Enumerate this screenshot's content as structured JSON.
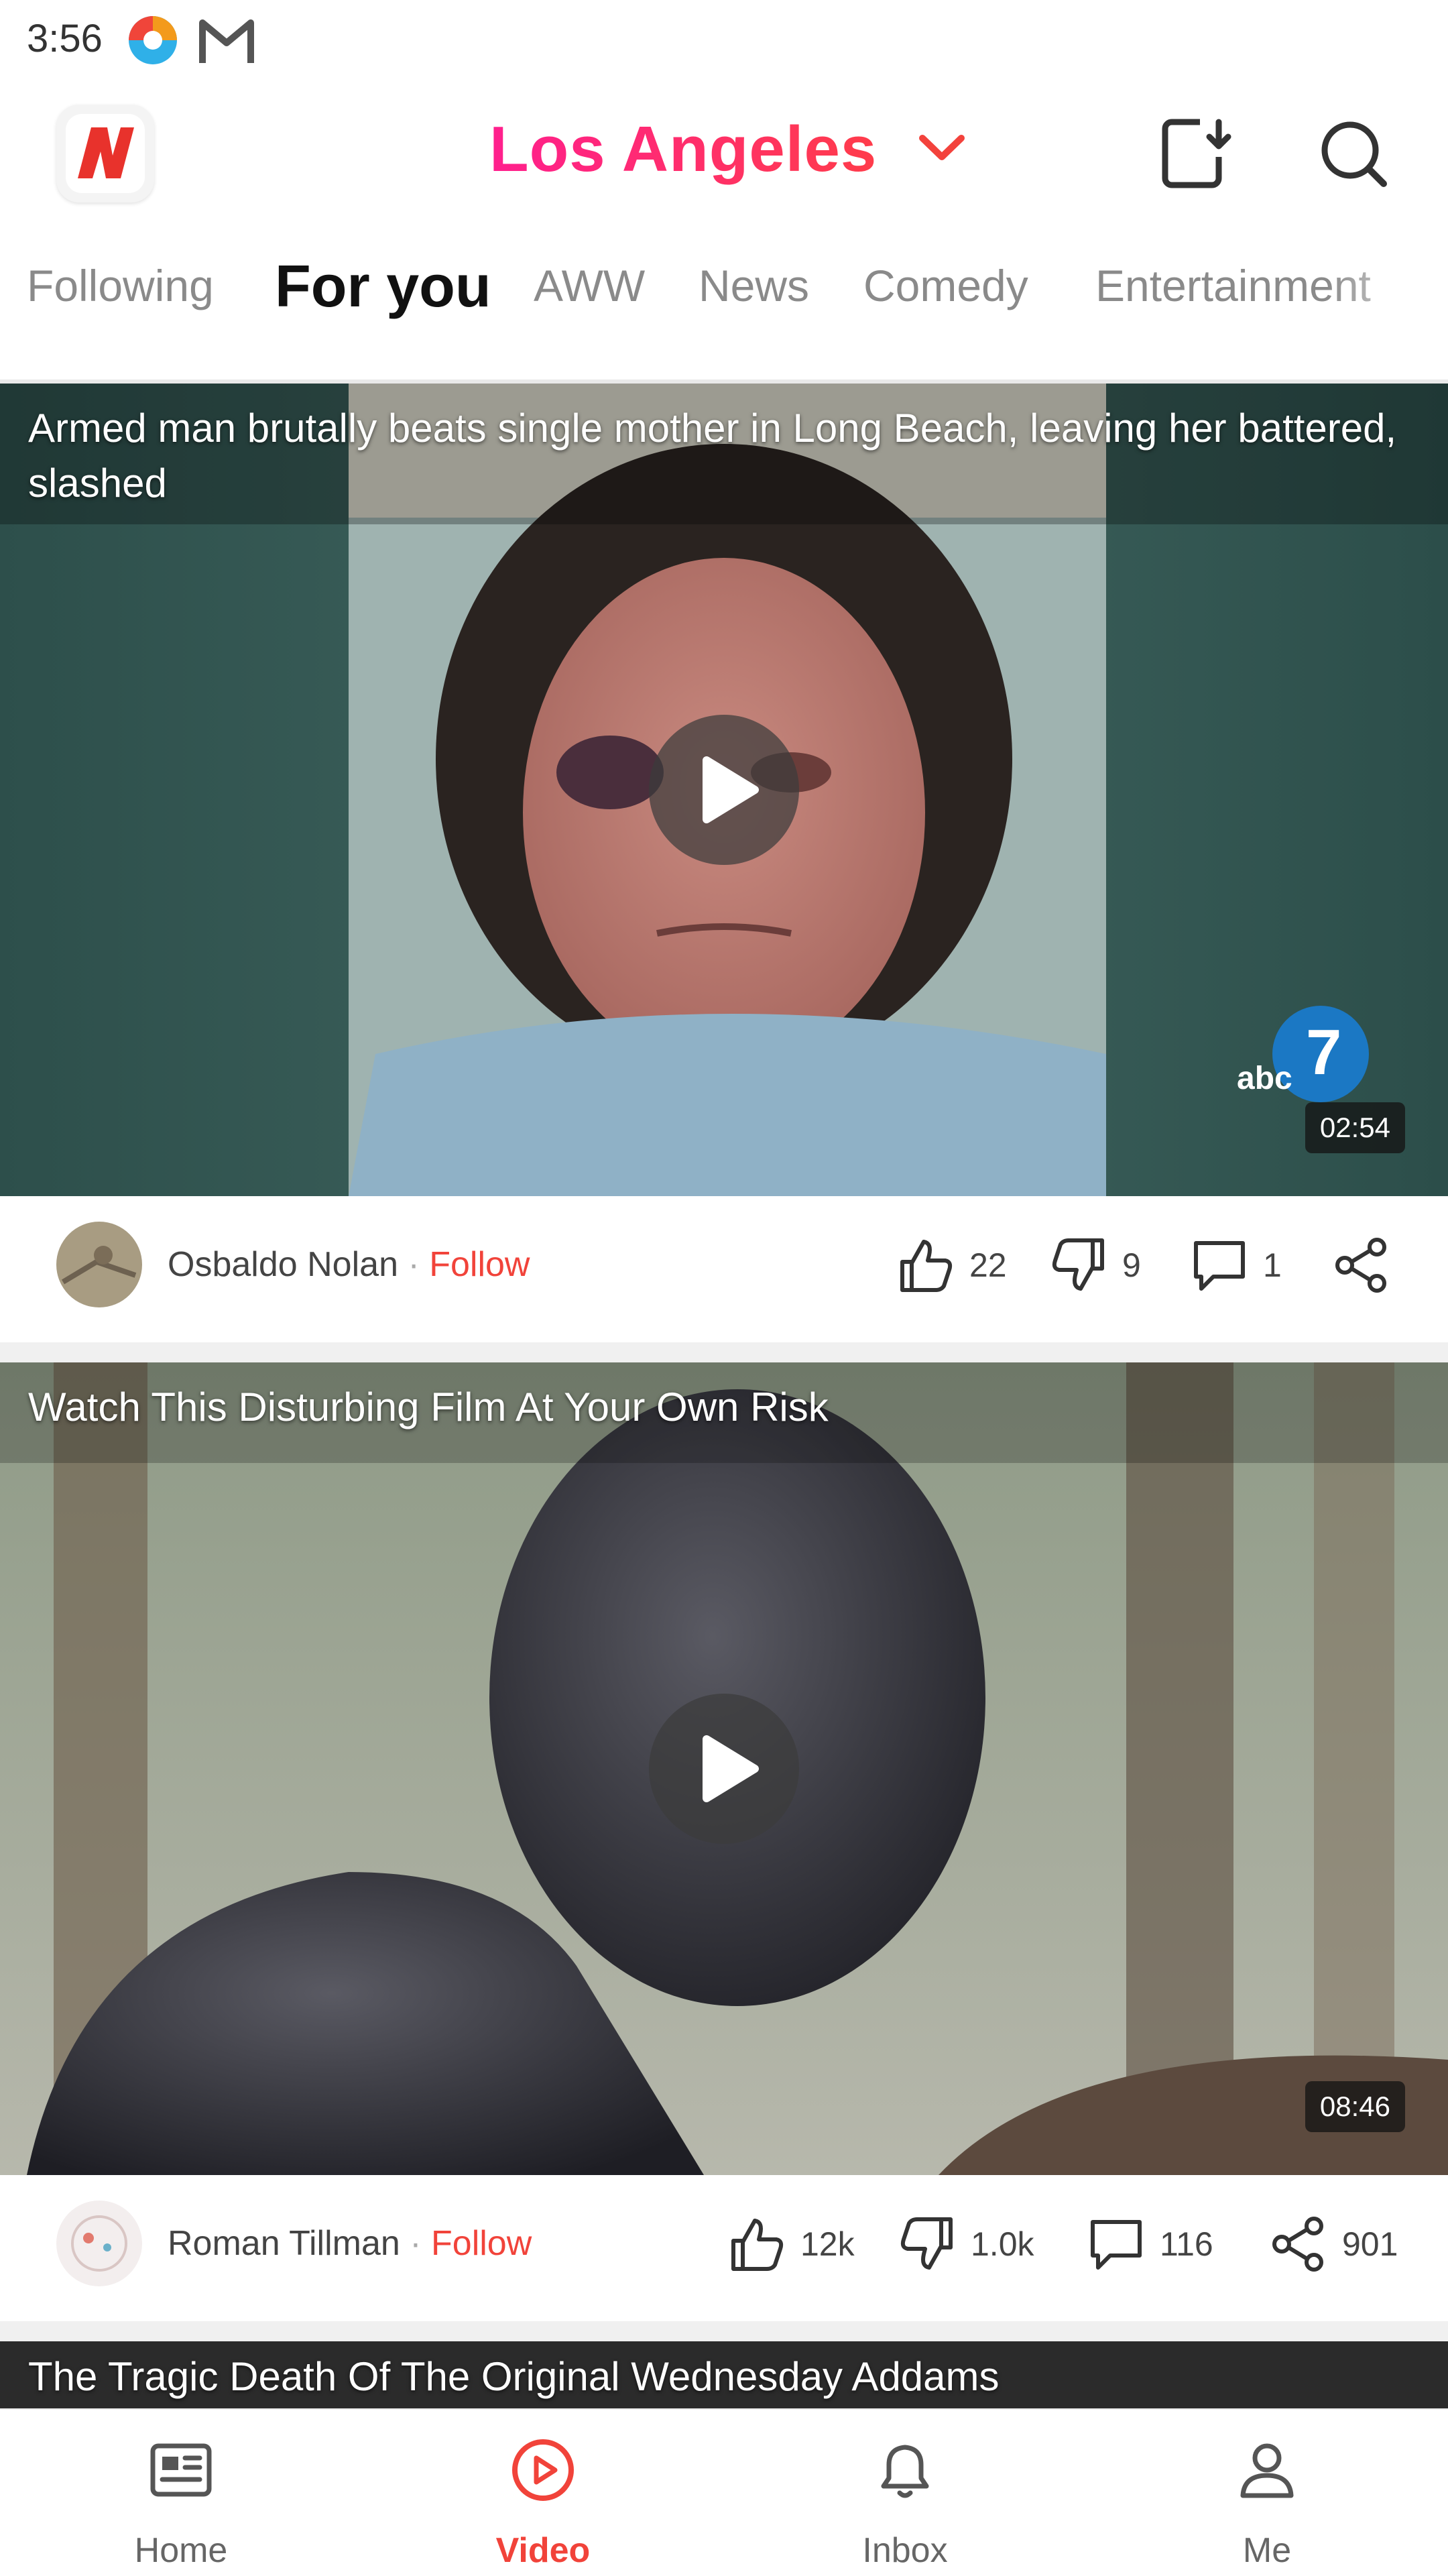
{
  "status_bar": {
    "time": "3:56",
    "icons": [
      "browser-app-icon",
      "gmail-icon"
    ]
  },
  "header": {
    "logo": "news-app-logo",
    "location": "Los Angeles",
    "icons": [
      "download-icon",
      "search-icon"
    ]
  },
  "tabs": [
    {
      "label": "Following",
      "active": false
    },
    {
      "label": "For you",
      "active": true
    },
    {
      "label": "AWW",
      "active": false
    },
    {
      "label": "News",
      "active": false
    },
    {
      "label": "Comedy",
      "active": false
    },
    {
      "label": "Entertainment",
      "active": false
    }
  ],
  "cards": [
    {
      "title": "Armed man brutally beats single mother in Long Beach, leaving her battered, slashed",
      "duration": "02:54",
      "watermark": "abc7.com",
      "author": "Osbaldo Nolan",
      "follow": "Follow",
      "likes": "22",
      "dislikes": "9",
      "comments": "1",
      "shares": ""
    },
    {
      "title": "Watch This Disturbing Film At Your Own Risk",
      "duration": "08:46",
      "author": "Roman Tillman",
      "follow": "Follow",
      "likes": "12k",
      "dislikes": "1.0k",
      "comments": "116",
      "shares": "901"
    },
    {
      "title": "The Tragic Death Of The Original Wednesday Addams"
    }
  ],
  "bottom_nav": [
    {
      "label": "Home",
      "icon": "newspaper-icon",
      "active": false
    },
    {
      "label": "Video",
      "icon": "play-circle-icon",
      "active": true
    },
    {
      "label": "Inbox",
      "icon": "bell-icon",
      "active": false
    },
    {
      "label": "Me",
      "icon": "person-icon",
      "active": false
    }
  ],
  "colors": {
    "accent": "#f1433a",
    "location_gradient": [
      "#ff1f8e",
      "#ff3c4a"
    ]
  }
}
